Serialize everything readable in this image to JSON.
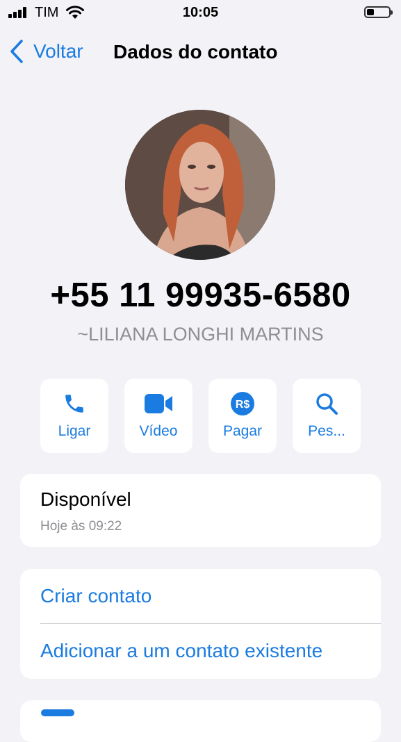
{
  "status_bar": {
    "carrier": "TIM",
    "time": "10:05"
  },
  "nav": {
    "back_label": "Voltar",
    "title": "Dados do contato"
  },
  "contact": {
    "phone": "+55 11 99935-6580",
    "name": "~LILIANA LONGHI MARTINS"
  },
  "actions": [
    {
      "label": "Ligar",
      "icon": "phone-icon"
    },
    {
      "label": "Vídeo",
      "icon": "video-camera-icon"
    },
    {
      "label": "Pagar",
      "icon": "payment-real-icon",
      "icon_text": "R$"
    },
    {
      "label": "Pes...",
      "icon": "search-icon"
    }
  ],
  "availability": {
    "status": "Disponível",
    "timestamp": "Hoje às 09:22"
  },
  "contact_options": {
    "create": "Criar contato",
    "add_existing": "Adicionar a um contato existente"
  },
  "colors": {
    "accent": "#1a7be0",
    "background": "#f2f2f7",
    "secondary_text": "#8e8e93"
  }
}
